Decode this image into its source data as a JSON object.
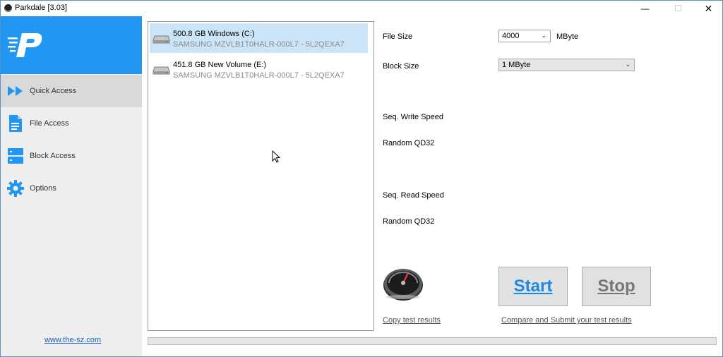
{
  "window": {
    "title": "Parkdale [3.03]",
    "controls": {
      "minimize": "—",
      "maximize": "☐",
      "close": "✕"
    }
  },
  "sidebar": {
    "logo_letter": "P",
    "items": [
      {
        "label": "Quick Access",
        "icon": "double-chevron-right-icon",
        "active": true
      },
      {
        "label": "File Access",
        "icon": "file-icon",
        "active": false
      },
      {
        "label": "Block Access",
        "icon": "server-blocks-icon",
        "active": false
      },
      {
        "label": "Options",
        "icon": "gear-icon",
        "active": false
      }
    ],
    "footer_link": "www.the-sz.com"
  },
  "drives": [
    {
      "name": "500.8 GB Windows (C:)",
      "model": "SAMSUNG MZVLB1T0HALR-000L7 - 5L2QEXA7",
      "selected": true
    },
    {
      "name": "451.8 GB New Volume (E:)",
      "model": "SAMSUNG MZVLB1T0HALR-000L7 - 5L2QEXA7",
      "selected": false
    }
  ],
  "settings": {
    "file_size_label": "File Size",
    "file_size_value": "4000",
    "file_size_unit": "MByte",
    "block_size_label": "Block Size",
    "block_size_value": "1 MByte"
  },
  "results": {
    "seq_write_label": "Seq. Write Speed",
    "random_write_label": "Random QD32",
    "seq_read_label": "Seq. Read Speed",
    "random_read_label": "Random QD32"
  },
  "actions": {
    "start_label": "Start",
    "stop_label": "Stop",
    "copy_results_link": "Copy test results",
    "compare_link": "Compare and Submit your test results"
  },
  "progress": {
    "value": 0
  },
  "colors": {
    "accent": "#2196f3",
    "start_text": "#1e88e5",
    "selection": "#cce4f7",
    "sidebar_bg": "#eeeeee"
  }
}
